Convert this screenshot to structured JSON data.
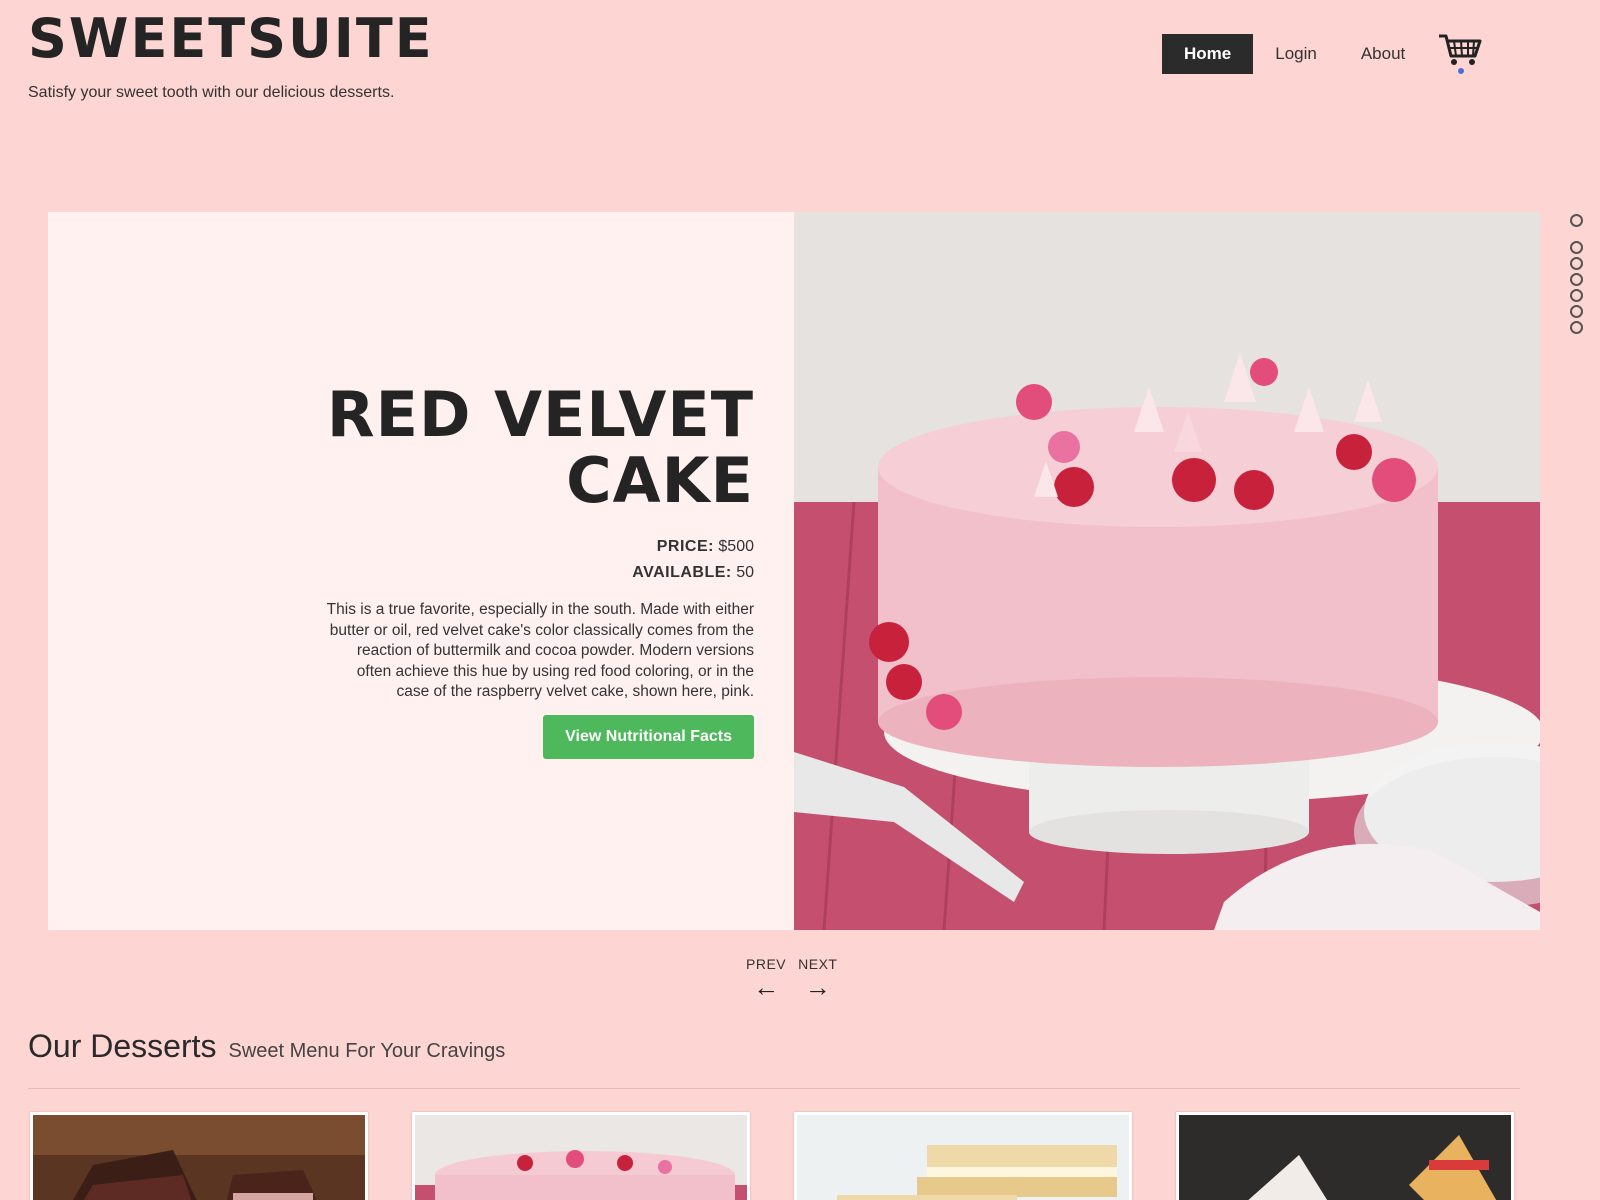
{
  "brand": {
    "title": "SWEETSUITE",
    "tagline": "Satisfy your sweet tooth with our delicious desserts."
  },
  "nav": {
    "items": [
      {
        "label": "Home",
        "active": true
      },
      {
        "label": "Login",
        "active": false
      },
      {
        "label": "About",
        "active": false
      }
    ],
    "cart_icon": "shopping-cart-icon"
  },
  "hero": {
    "title_line1": "RED VELVET",
    "title_line2": "CAKE",
    "price_key": "PRICE:",
    "price_value": "$500",
    "available_key": "AVAILABLE:",
    "available_value": "50",
    "description": "This is a true favorite, especially in the south. Made with either butter or oil, red velvet cake's color classically comes from the reaction of buttermilk and cocoa powder. Modern versions often achieve this hue by using red food coloring, or in the case of the raspberry velvet cake, shown here, pink.",
    "button_label": "View Nutritional Facts",
    "button_color": "#4db85c"
  },
  "slider": {
    "dot_count": 7,
    "prev_label": "PREV",
    "next_label": "NEXT",
    "prev_arrow": "←",
    "next_arrow": "→"
  },
  "desserts": {
    "title": "Our Desserts",
    "subtitle": "Sweet Menu For Your Cravings"
  },
  "colors": {
    "background": "#fdd5d2",
    "panel": "#fff1f0",
    "accent": "#2b2b2b"
  }
}
